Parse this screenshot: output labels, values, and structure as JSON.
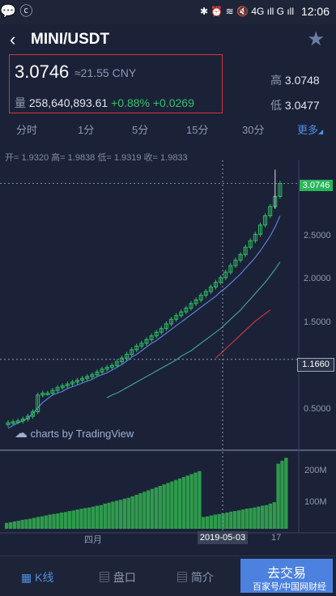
{
  "status_bar": {
    "left_icons": "💬 ⓒ",
    "right_icons": "✱ ⏰ ≋ 🔇 4G ıll G ıll",
    "time": "12:06"
  },
  "header": {
    "pair": "MINI/USDT"
  },
  "ticker": {
    "price": "3.0746",
    "cny": "≈21.55 CNY",
    "volume_label": "量",
    "volume": "258,640,893.61",
    "change_pct": "+0.88%",
    "change_abs": "+0.0269",
    "high_label": "高",
    "high": "3.0748",
    "low_label": "低",
    "low": "3.0477"
  },
  "tabs": [
    "分时",
    "1分",
    "5分",
    "15分",
    "30分",
    "更多"
  ],
  "ohlc_text": "开= 1.9320  高= 1.9838  低= 1.9319  收= 1.9833",
  "watermark_text": "charts by TradingView",
  "chart_data": {
    "type": "line",
    "price_axis": [
      "3.0746",
      "2.5000",
      "2.0000",
      "1.5000",
      "1.1660",
      "0.5000"
    ],
    "volume_axis": [
      "200M",
      "100M"
    ],
    "time_axis": [
      "四月",
      "2019-05-03",
      "17"
    ],
    "last_price": "3.0746",
    "crosshair_price": "1.1660",
    "crosshair_date": "2019-05-03",
    "ylim": [
      0.2,
      3.25
    ],
    "close": [
      0.48,
      0.49,
      0.5,
      0.52,
      0.55,
      0.6,
      0.78,
      0.8,
      0.8,
      0.83,
      0.86,
      0.88,
      0.9,
      0.92,
      0.94,
      0.96,
      0.98,
      1.0,
      1.03,
      1.06,
      1.08,
      1.1,
      1.14,
      1.18,
      1.22,
      1.27,
      1.31,
      1.34,
      1.38,
      1.42,
      1.46,
      1.5,
      1.55,
      1.6,
      1.64,
      1.68,
      1.72,
      1.77,
      1.81,
      1.86,
      1.9,
      1.95,
      2.0,
      2.05,
      2.11,
      2.18,
      2.24,
      2.3,
      2.38,
      2.45,
      2.52,
      2.62,
      2.72,
      2.82,
      2.93,
      3.07
    ],
    "ma_short": [
      0.42,
      0.45,
      0.48,
      0.5,
      0.53,
      0.58,
      0.64,
      0.7,
      0.74,
      0.78,
      0.8,
      0.82,
      0.85,
      0.87,
      0.89,
      0.91,
      0.93,
      0.95,
      0.98,
      1.0,
      1.02,
      1.05,
      1.08,
      1.11,
      1.15,
      1.19,
      1.22,
      1.26,
      1.3,
      1.34,
      1.37,
      1.41,
      1.45,
      1.49,
      1.53,
      1.57,
      1.61,
      1.65,
      1.69,
      1.73,
      1.77,
      1.81,
      1.85,
      1.9,
      1.94,
      1.99,
      2.04,
      2.09,
      2.15,
      2.21,
      2.27,
      2.34,
      2.42,
      2.5,
      2.6,
      2.72
    ],
    "ma_mid_start": 20,
    "ma_mid": [
      0.75,
      0.78,
      0.8,
      0.83,
      0.86,
      0.89,
      0.92,
      0.95,
      0.98,
      1.01,
      1.04,
      1.07,
      1.1,
      1.13,
      1.16,
      1.2,
      1.23,
      1.26,
      1.3,
      1.34,
      1.38,
      1.42,
      1.46,
      1.5,
      1.55,
      1.6,
      1.65,
      1.7,
      1.76,
      1.82,
      1.88,
      1.94,
      2.0,
      2.07,
      2.14,
      2.22
    ],
    "ma_long_start": 42,
    "ma_long": [
      1.18,
      1.23,
      1.28,
      1.33,
      1.38,
      1.43,
      1.48,
      1.53,
      1.58,
      1.62,
      1.66,
      1.7
    ],
    "volume": [
      20,
      22,
      25,
      27,
      30,
      32,
      34,
      37,
      40,
      42,
      45,
      48,
      50,
      52,
      55,
      57,
      60,
      62,
      65,
      68,
      70,
      72,
      75,
      78,
      80,
      85,
      88,
      92,
      95,
      98,
      102,
      105,
      110,
      115,
      120,
      125,
      130,
      135,
      140,
      145,
      150,
      155,
      160,
      165,
      170,
      175,
      180,
      185,
      190,
      195,
      40,
      42,
      45,
      48,
      50,
      52,
      55,
      58,
      60,
      62,
      65,
      68,
      70,
      72,
      75,
      78,
      80,
      85,
      90,
      220,
      230,
      240
    ],
    "volume_max": 260
  },
  "date_tag": "2019-05-03",
  "bottom_nav": [
    {
      "label": "K线",
      "icon": "bar-chart-icon"
    },
    {
      "label": "盘口",
      "icon": "orderbook-icon"
    },
    {
      "label": "简介",
      "icon": "document-icon"
    }
  ],
  "trade_button": "去交易",
  "footer_watermark": "百家号/中国网财经"
}
